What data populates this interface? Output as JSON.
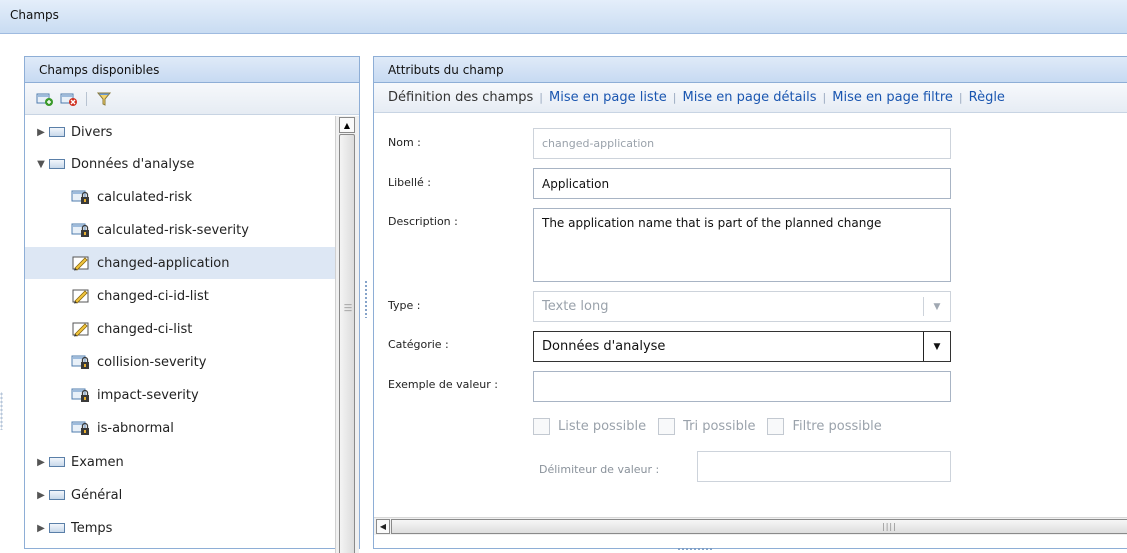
{
  "window": {
    "title": "Champs"
  },
  "left_panel": {
    "title": "Champs disponibles",
    "toolbar": {
      "add_icon": "add-field-icon",
      "delete_icon": "delete-field-icon",
      "filter_icon": "filter-icon"
    },
    "tree": [
      {
        "label": "Divers",
        "type": "folder",
        "expanded": false
      },
      {
        "label": "Données d'analyse",
        "type": "folder",
        "expanded": true
      },
      {
        "label": "calculated-risk",
        "type": "locked-field"
      },
      {
        "label": "calculated-risk-severity",
        "type": "locked-field"
      },
      {
        "label": "changed-application",
        "type": "editable-field",
        "selected": true
      },
      {
        "label": "changed-ci-id-list",
        "type": "editable-field"
      },
      {
        "label": "changed-ci-list",
        "type": "editable-field"
      },
      {
        "label": "collision-severity",
        "type": "locked-field"
      },
      {
        "label": "impact-severity",
        "type": "locked-field"
      },
      {
        "label": "is-abnormal",
        "type": "locked-field"
      },
      {
        "label": "Examen",
        "type": "folder",
        "expanded": false
      },
      {
        "label": "Général",
        "type": "folder",
        "expanded": false
      },
      {
        "label": "Temps",
        "type": "folder",
        "expanded": false
      }
    ]
  },
  "right_panel": {
    "title": "Attributs du champ",
    "tabs": [
      {
        "label": "Définition des champs",
        "active": true
      },
      {
        "label": "Mise en page liste"
      },
      {
        "label": "Mise en page détails"
      },
      {
        "label": "Mise en page filtre"
      },
      {
        "label": "Règle"
      }
    ],
    "form": {
      "name_label": "Nom :",
      "name_value": "changed-application",
      "libelle_label": "Libellé :",
      "libelle_value": "Application",
      "description_label": "Description :",
      "description_value": "The application name that is part of the planned change",
      "type_label": "Type :",
      "type_value": "Texte long",
      "category_label": "Catégorie :",
      "category_value": "Données d'analyse",
      "example_label": "Exemple de valeur :",
      "example_value": "",
      "checkboxes": {
        "list": "Liste possible",
        "sort": "Tri possible",
        "filter": "Filtre possible"
      },
      "delimiter_label": "Délimiteur de valeur :",
      "delimiter_value": ""
    }
  },
  "colors": {
    "header_gradient_top": "#dfeaf8",
    "header_gradient_bottom": "#c7daf2",
    "link": "#1a56b0",
    "selected_row": "#dde7f4"
  }
}
